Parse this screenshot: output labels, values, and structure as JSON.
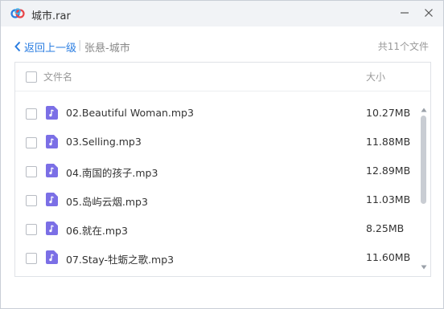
{
  "window": {
    "title": "城市.rar",
    "logo_icon": "cloud-logo-icon",
    "minimize_icon": "minimize-icon",
    "close_icon": "close-icon"
  },
  "nav": {
    "back_label": "返回上一级",
    "separator": "|",
    "path": "张悬-城市",
    "file_count": "共11个文件"
  },
  "table": {
    "header": {
      "name": "文件名",
      "size": "大小"
    },
    "rows": [
      {
        "name": "02.Beautiful Woman.mp3",
        "size": "10.27MB"
      },
      {
        "name": "03.Selling.mp3",
        "size": "11.88MB"
      },
      {
        "name": "04.南国的孩子.mp3",
        "size": "12.89MB"
      },
      {
        "name": "05.岛屿云烟.mp3",
        "size": "11.03MB"
      },
      {
        "name": "06.就在.mp3",
        "size": "8.25MB"
      },
      {
        "name": "07.Stay-牡蛎之歌.mp3",
        "size": "11.60MB"
      }
    ]
  },
  "colors": {
    "accent": "#2a7de1",
    "music_icon": "#7b6fe6",
    "titlebar": "#f1f3f6"
  }
}
